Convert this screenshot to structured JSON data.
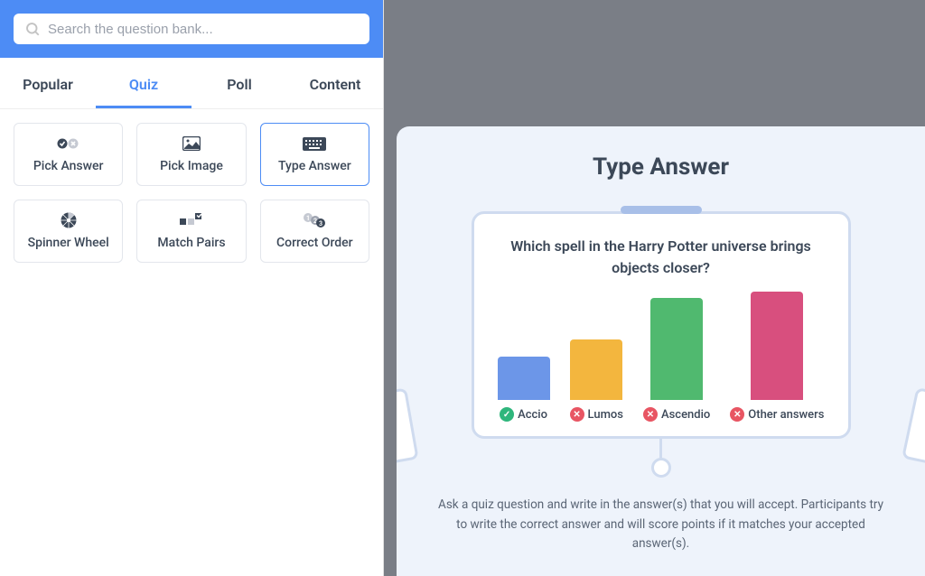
{
  "search": {
    "placeholder": "Search the question bank..."
  },
  "tabs": [
    {
      "label": "Popular",
      "active": false
    },
    {
      "label": "Quiz",
      "active": true
    },
    {
      "label": "Poll",
      "active": false
    },
    {
      "label": "Content",
      "active": false
    }
  ],
  "cards": [
    {
      "id": "pick-answer",
      "label": "Pick Answer",
      "icon": "check-x-icon",
      "selected": false
    },
    {
      "id": "pick-image",
      "label": "Pick Image",
      "icon": "image-icon",
      "selected": false
    },
    {
      "id": "type-answer",
      "label": "Type Answer",
      "icon": "keyboard-icon",
      "selected": true
    },
    {
      "id": "spinner-wheel",
      "label": "Spinner Wheel",
      "icon": "wheel-icon",
      "selected": false
    },
    {
      "id": "match-pairs",
      "label": "Match Pairs",
      "icon": "pairs-icon",
      "selected": false
    },
    {
      "id": "correct-order",
      "label": "Correct Order",
      "icon": "order-icon",
      "selected": false
    }
  ],
  "preview": {
    "title": "Type Answer",
    "question": "Which spell in the Harry Potter universe brings objects closer?",
    "description": "Ask a quiz question and write in the answer(s) that you will accept. Participants try to write the correct answer and will score points if it matches your accepted answer(s)."
  },
  "chart_data": {
    "type": "bar",
    "categories": [
      "Accio",
      "Lumos",
      "Ascendio",
      "Other answers"
    ],
    "values": [
      40,
      56,
      94,
      100
    ],
    "status": [
      "correct",
      "wrong",
      "wrong",
      "wrong"
    ],
    "colors": [
      "#6c96e8",
      "#f3b63e",
      "#50b96f",
      "#d84f7e"
    ],
    "ylim": [
      0,
      100
    ]
  }
}
